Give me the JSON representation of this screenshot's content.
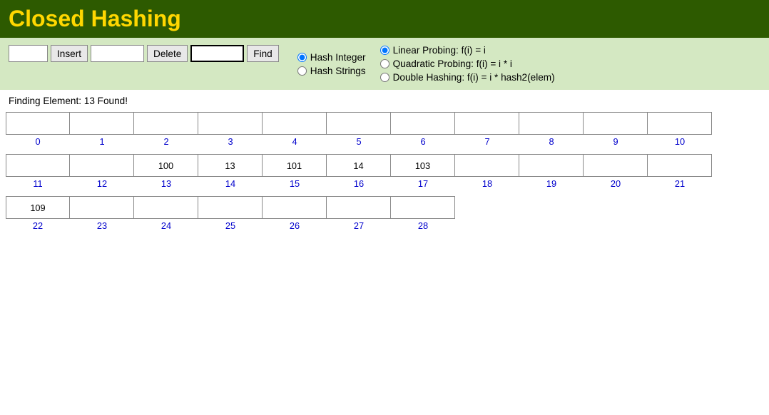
{
  "header": {
    "title": "Closed Hashing"
  },
  "toolbar": {
    "insert_placeholder": "",
    "insert_label": "Insert",
    "delete_placeholder": "",
    "delete_label": "Delete",
    "find_input_value": "",
    "find_label": "Find"
  },
  "hash_type": {
    "option1": "Hash Integer",
    "option2": "Hash Strings"
  },
  "probing": {
    "option1": "Linear Probing: f(i) = i",
    "option2": "Quadratic Probing: f(i) = i * i",
    "option3": "Double Hashing: f(i) = i * hash2(elem)"
  },
  "status": "Finding Element: 13  Found!",
  "rows": [
    {
      "cells": [
        "",
        "",
        "",
        "",
        "",
        "",
        "",
        "",
        "",
        "",
        ""
      ],
      "labels": [
        "0",
        "1",
        "2",
        "3",
        "4",
        "5",
        "6",
        "7",
        "8",
        "9",
        "10"
      ]
    },
    {
      "cells": [
        "",
        "",
        "100",
        "13",
        "101",
        "14",
        "103",
        "",
        "",
        "",
        ""
      ],
      "labels": [
        "11",
        "12",
        "13",
        "14",
        "15",
        "16",
        "17",
        "18",
        "19",
        "20",
        "21"
      ]
    },
    {
      "cells": [
        "109",
        "",
        "",
        "",
        "",
        "",
        ""
      ],
      "labels": [
        "22",
        "23",
        "24",
        "25",
        "26",
        "27",
        "28"
      ]
    }
  ]
}
